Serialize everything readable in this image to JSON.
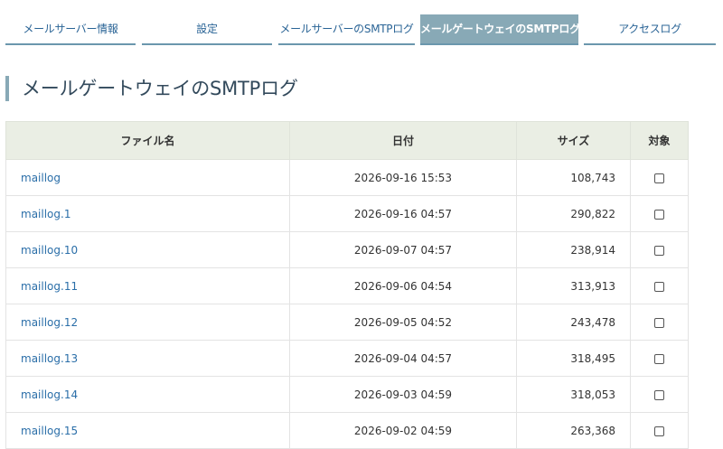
{
  "tabs": [
    {
      "label": "メールサーバー情報",
      "active": false
    },
    {
      "label": "設定",
      "active": false
    },
    {
      "label": "メールサーバーのSMTPログ",
      "active": false
    },
    {
      "label": "メールゲートウェイのSMTPログ",
      "active": true
    },
    {
      "label": "アクセスログ",
      "active": false
    }
  ],
  "page": {
    "title": "メールゲートウェイのSMTPログ"
  },
  "table": {
    "headers": {
      "filename": "ファイル名",
      "date": "日付",
      "size": "サイズ",
      "target": "対象"
    },
    "rows": [
      {
        "filename": "maillog",
        "date": "2026-09-16 15:53",
        "size": "108,743"
      },
      {
        "filename": "maillog.1",
        "date": "2026-09-16 04:57",
        "size": "290,822"
      },
      {
        "filename": "maillog.10",
        "date": "2026-09-07 04:57",
        "size": "238,914"
      },
      {
        "filename": "maillog.11",
        "date": "2026-09-06 04:54",
        "size": "313,913"
      },
      {
        "filename": "maillog.12",
        "date": "2026-09-05 04:52",
        "size": "243,478"
      },
      {
        "filename": "maillog.13",
        "date": "2026-09-04 04:57",
        "size": "318,495"
      },
      {
        "filename": "maillog.14",
        "date": "2026-09-03 04:59",
        "size": "318,053"
      },
      {
        "filename": "maillog.15",
        "date": "2026-09-02 04:59",
        "size": "263,368"
      }
    ]
  },
  "colors": {
    "accent": "#88a9b6",
    "link": "#2a6ea8",
    "header_bg": "#eaeee4"
  }
}
